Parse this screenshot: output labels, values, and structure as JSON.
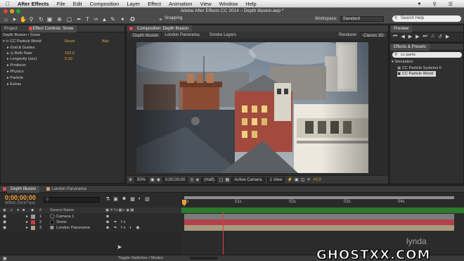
{
  "menubar": {
    "app_name": "After Effects",
    "items": [
      "File",
      "Edit",
      "Composition",
      "Layer",
      "Effect",
      "Animation",
      "View",
      "Window",
      "Help"
    ]
  },
  "toolbar": {
    "window_title": "Adobe After Effects CC 2014 – Depth Illusion.aep *",
    "snapping_label": "Snapping",
    "workspace_label": "Workspace:",
    "workspace_value": "Standard",
    "search_placeholder": "Search Help"
  },
  "left_panel": {
    "tabs": [
      "Project",
      "Effect Controls: Snow"
    ],
    "layer_path": "Depth Illusion • Snow",
    "effect_name": "CC Particle World",
    "reset_label": "Reset",
    "about_label": "Abo",
    "props": [
      {
        "label": "Grid & Guides"
      },
      {
        "label": "Birth Rate",
        "value": "150.0"
      },
      {
        "label": "Longevity (sec)",
        "value": "5.00"
      },
      {
        "label": "Producer"
      },
      {
        "label": "Physics"
      },
      {
        "label": "Particle"
      },
      {
        "label": "Extras"
      }
    ]
  },
  "composition": {
    "panel_tab": "Composition: Depth Illusion",
    "sub_tabs": [
      "Depth Illusion",
      "London Panorama",
      "Smoke Layers"
    ],
    "renderer_label": "Renderer:",
    "renderer_value": "Classic 3D",
    "footer": {
      "zoom": "50%",
      "timecode": "0;00;00;00",
      "resolution": "(Half)",
      "camera": "Active Camera",
      "views": "1 View",
      "exposure": "+0.0"
    }
  },
  "right_panel": {
    "preview_label": "Preview",
    "effects_presets_label": "Effects & Presets",
    "search_value": "cc partic",
    "category": "Simulation",
    "items": [
      "CC Particle Systems II",
      "CC Particle World"
    ]
  },
  "timeline": {
    "tabs": [
      "Depth Illusion",
      "London Panorama"
    ],
    "timecode": "0;00;00;00",
    "fps": "00000 (29.97 fps)",
    "source_name_header": "Source Name",
    "layers": [
      {
        "num": "1",
        "name": "Camera 1",
        "color": "#9a9a9a"
      },
      {
        "num": "2",
        "name": "Snow",
        "color": "#c33c46"
      },
      {
        "num": "3",
        "name": "London Panorama",
        "color": "#b5a17a"
      }
    ],
    "ruler_labels": [
      "0s",
      "01s",
      "02s",
      "03s",
      "04s"
    ],
    "toggle_label": "Toggle Switches / Modes"
  },
  "watermark": {
    "text": "GHOSTXX.COM",
    "lynda": "lynda"
  }
}
